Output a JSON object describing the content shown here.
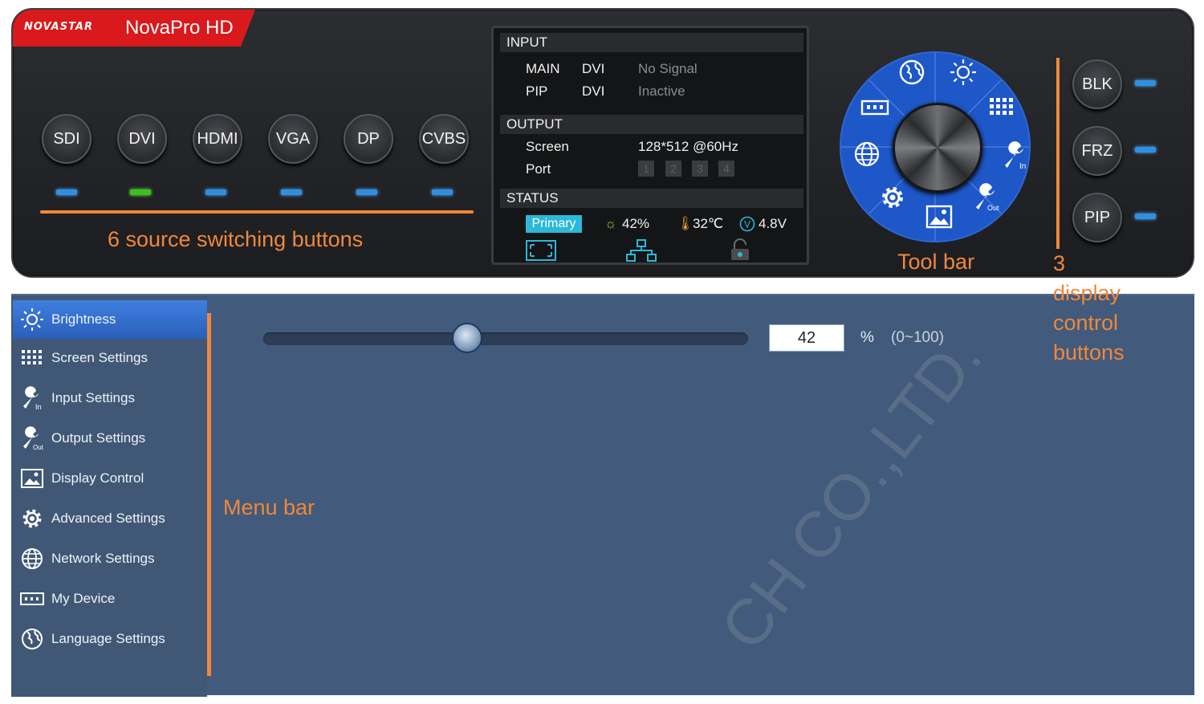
{
  "brand": {
    "logo": "NOVASTAR",
    "model": "NovaPro HD"
  },
  "source_buttons": [
    "SDI",
    "DVI",
    "HDMI",
    "VGA",
    "DP",
    "CVBS"
  ],
  "source_led_colors": [
    "#2f8fe3",
    "#39c21c",
    "#2f8fe3",
    "#2f8fe3",
    "#2f8fe3",
    "#2f8fe3"
  ],
  "annotations": {
    "sources": "6 source switching buttons",
    "toolbar": "Tool bar",
    "display_1": "3",
    "display_2": "display",
    "display_3": "control",
    "display_4": "buttons",
    "menu": "Menu bar"
  },
  "lcd": {
    "input_header": "INPUT",
    "main_label": "MAIN",
    "main_src": "DVI",
    "main_status": "No Signal",
    "pip_label": "PIP",
    "pip_src": "DVI",
    "pip_status": "Inactive",
    "output_header": "OUTPUT",
    "screen_label": "Screen",
    "screen_value": "128*512 @60Hz",
    "port_label": "Port",
    "ports": [
      "1",
      "2",
      "3",
      "4"
    ],
    "status_header": "STATUS",
    "primary": "Primary",
    "brightness": "42%",
    "temperature": "32℃",
    "voltage": "4.8V"
  },
  "display_buttons": [
    "BLK",
    "FRZ",
    "PIP"
  ],
  "menu": {
    "items": [
      {
        "label": "Brightness",
        "icon": "sun-icon"
      },
      {
        "label": "Screen Settings",
        "icon": "grid-icon"
      },
      {
        "label": "Input Settings",
        "icon": "wrench-in-icon"
      },
      {
        "label": "Output Settings",
        "icon": "wrench-out-icon"
      },
      {
        "label": "Display Control",
        "icon": "picture-icon"
      },
      {
        "label": "Advanced Settings",
        "icon": "gear-icon"
      },
      {
        "label": "Network Settings",
        "icon": "globe-icon"
      },
      {
        "label": "My Device",
        "icon": "device-icon"
      },
      {
        "label": "Language Settings",
        "icon": "earth-icon"
      }
    ],
    "active": "Brightness"
  },
  "brightness": {
    "value": "42",
    "unit": "%",
    "range": "(0~100)",
    "level": 0.42
  },
  "colors": {
    "accent_orange": "#f0883a",
    "wheel_blue": "#1e57c8",
    "menu_bg": "#405876",
    "content_bg": "#425a7b",
    "brand_red": "#d9191c"
  },
  "watermark": "CH CO.,LTD."
}
